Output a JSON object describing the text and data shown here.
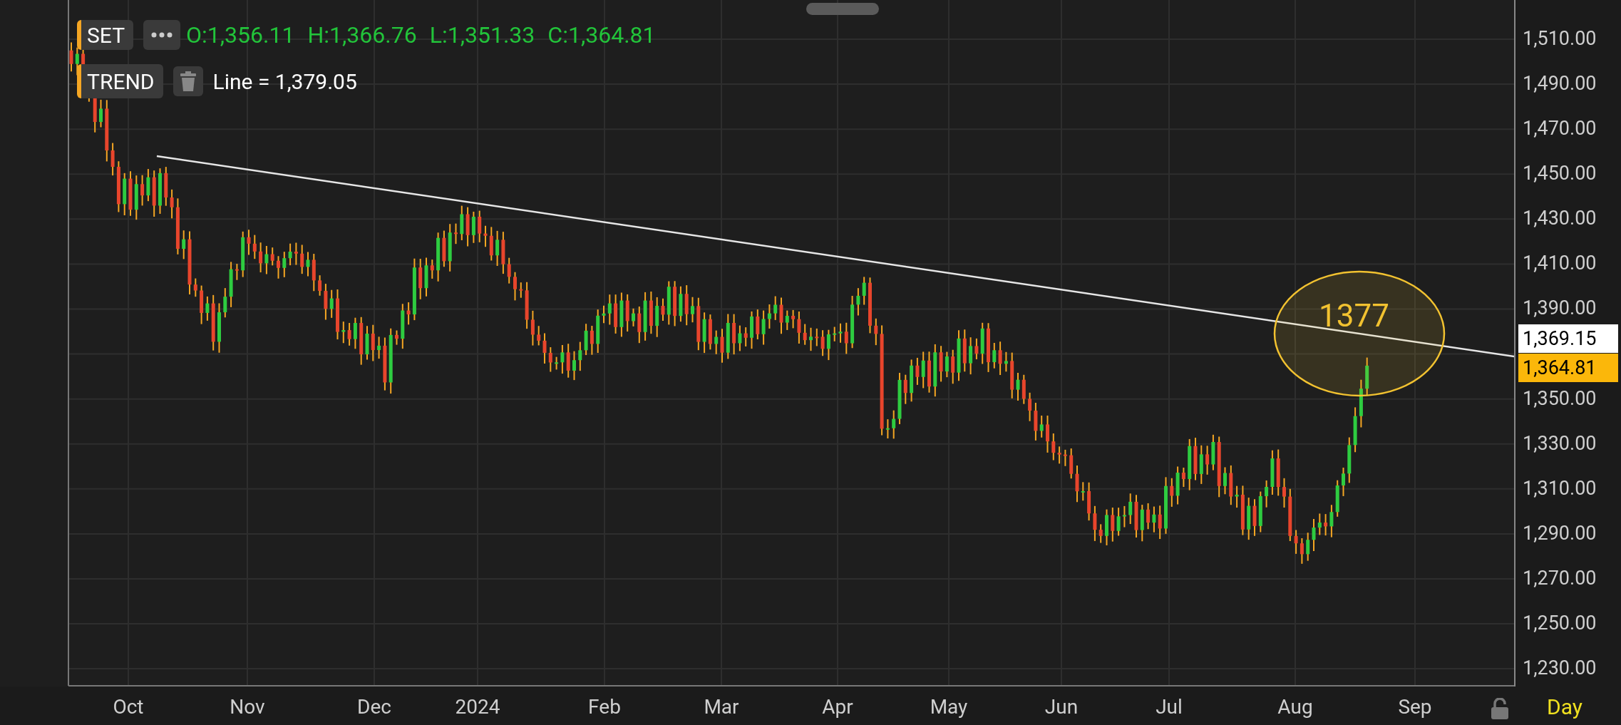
{
  "legend": {
    "symbol": "SET",
    "ohlc": [
      "O:1,356.11",
      "H:1,366.76",
      "L:1,351.33",
      "C:1,364.81"
    ]
  },
  "drawing": {
    "label": "TREND",
    "readout": "Line = 1,379.05"
  },
  "annotation": {
    "text": "1377"
  },
  "y_axis": {
    "labels": [
      "1,510.00",
      "1,490.00",
      "1,470.00",
      "1,450.00",
      "1,430.00",
      "1,410.00",
      "1,390.00",
      "1,350.00",
      "1,330.00",
      "1,310.00",
      "1,290.00",
      "1,270.00",
      "1,250.00",
      "1,230.00"
    ],
    "line_tag": "1,369.15",
    "price_tag": "1,364.81"
  },
  "x_axis": {
    "labels": [
      "Oct",
      "Nov",
      "Dec",
      "2024",
      "Feb",
      "Mar",
      "Apr",
      "May",
      "Jun",
      "Jul",
      "Aug",
      "Sep"
    ]
  },
  "interval": "Day"
}
